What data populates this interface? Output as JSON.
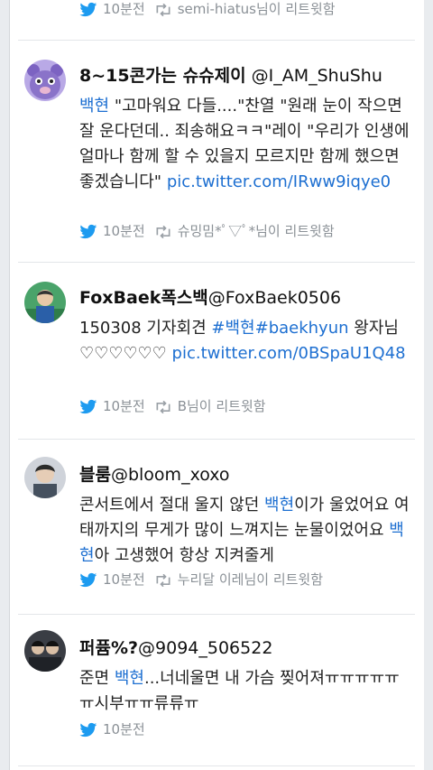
{
  "top_meta": {
    "time": "10분전",
    "retweet": "semi-hiatus님이 리트윗함"
  },
  "tweets": [
    {
      "name": "8~15콘가는 슈슈제이",
      "handle": "@I_AM_ShuShu",
      "body_parts": [
        "백현",
        " \"고마워요 다들....\"찬열 \"원래 눈이 작으면 잘 운다던데.. 죄송해요ㅋㅋ\"레이 \"우리가 인생에 얼마나 함께 할 수 있을지 모르지만 함께 했으면 좋겠습니다\" ",
        "pic.twitter.com/IRww9iqye0"
      ],
      "time": "10분전",
      "retweet": "슈밍밈*ﾟ▽ﾟ*님이 리트윗함",
      "avatar_color": "#8a73c9"
    },
    {
      "name": "FoxBaek폭스백",
      "handle": "@FoxBaek0506",
      "body_parts": [
        "150308 기자회견 ",
        "#백현#baekhyun",
        " 왕자님♡♡♡♡♡♡ ",
        "pic.twitter.com/0BSpaU1Q48"
      ],
      "time": "10분전",
      "retweet": "B님이 리트윗함",
      "avatar_color": "#3e8f5a"
    },
    {
      "name": "블룸",
      "handle": "@bloom_xoxo",
      "body_parts": [
        "콘서트에서 절대 울지 않던 ",
        "백현",
        "이가 울었어요 여태까지의 무게가 많이 느껴지는 눈물이었어요 ",
        "백현",
        "아 고생했어 항상 지켜줄게"
      ],
      "time": "10분전",
      "retweet": "누리달 이레님이 리트윗함",
      "avatar_color": "#6b6f7a"
    },
    {
      "name": "퍼퓸%?",
      "handle": "@9094_506522",
      "body_parts": [
        "준면 ",
        "백현",
        "...너네울면 내 가슴 찢어져ㅠㅠㅠㅠㅠㅠ시부ㅠㅠ류류ㅠ"
      ],
      "time": "10분전",
      "retweet": "",
      "avatar_color": "#3a3d44"
    }
  ]
}
